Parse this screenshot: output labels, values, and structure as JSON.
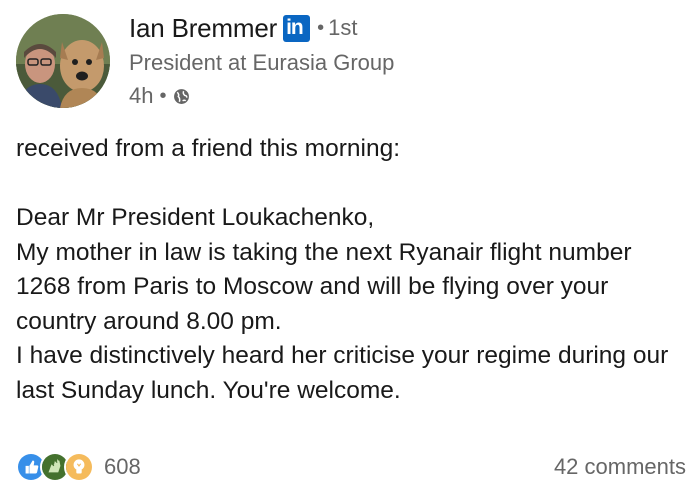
{
  "author": {
    "name": "Ian Bremmer",
    "badge": "in",
    "degree_separator": "•",
    "degree": "1st",
    "headline": "President at Eurasia Group"
  },
  "meta": {
    "time": "4h",
    "separator": "•",
    "visibility_icon": "globe-icon"
  },
  "post": {
    "text": "received from a friend this morning:\n\nDear Mr President Loukachenko,\nMy mother in law is taking the next Ryanair flight number 1268 from Paris to Moscow and will be flying over your country around 8.00 pm.\nI have distinctively heard her criticise your regime during our last Sunday lunch. You're welcome."
  },
  "social": {
    "reaction_icons": [
      "like-icon",
      "celebrate-icon",
      "insightful-icon"
    ],
    "reactions_count": "608",
    "comments": "42 comments"
  },
  "colors": {
    "linkedin_blue": "#0a66c2",
    "text_primary": "#191919",
    "text_secondary": "#666666",
    "like_blue": "#378fe9",
    "celebrate_green": "#44712e",
    "insightful_yellow": "#f5bb5c"
  }
}
